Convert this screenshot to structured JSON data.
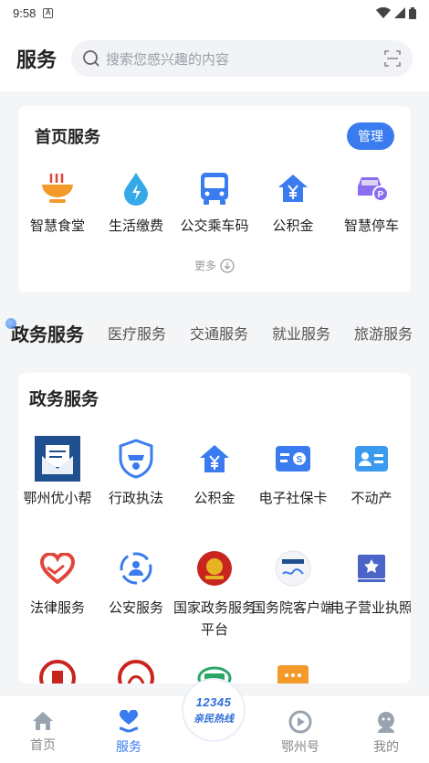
{
  "status_bar": {
    "time": "9:58",
    "notification_letter": "A"
  },
  "header": {
    "title": "服务",
    "search_placeholder": "搜索您感兴趣的内容"
  },
  "home_services": {
    "title": "首页服务",
    "manage_label": "管理",
    "more_label": "更多",
    "items": [
      {
        "label": "智慧食堂",
        "icon": "noodle-bowl-icon"
      },
      {
        "label": "生活缴费",
        "icon": "water-drop-icon"
      },
      {
        "label": "公交乘车码",
        "icon": "bus-icon"
      },
      {
        "label": "公积金",
        "icon": "house-yen-icon"
      },
      {
        "label": "智慧停车",
        "icon": "car-parking-icon"
      }
    ]
  },
  "tabs": [
    "政务服务",
    "医疗服务",
    "交通服务",
    "就业服务",
    "旅游服务"
  ],
  "gov_services": {
    "title": "政务服务",
    "items": [
      {
        "label": "鄂州优小帮",
        "icon": "mail-app-icon"
      },
      {
        "label": "行政执法",
        "icon": "police-badge-icon"
      },
      {
        "label": "公积金",
        "icon": "house-yen-icon"
      },
      {
        "label": "电子社保卡",
        "icon": "social-card-icon"
      },
      {
        "label": "不动产",
        "icon": "id-card-icon"
      },
      {
        "label": "法律服务",
        "icon": "heart-hands-icon"
      },
      {
        "label": "公安服务",
        "icon": "people-shield-icon"
      },
      {
        "label": "国家政务服务平台",
        "icon": "national-emblem-icon"
      },
      {
        "label": "国务院客户端",
        "icon": "state-council-icon"
      },
      {
        "label": "电子营业执照",
        "icon": "license-star-icon"
      },
      {
        "label": "",
        "icon": "court-emblem-icon"
      },
      {
        "label": "",
        "icon": "procuratorate-emblem-icon"
      },
      {
        "label": "",
        "icon": "e-service-logo-icon"
      },
      {
        "label": "",
        "icon": "chat-bubble-icon"
      }
    ]
  },
  "hotline": {
    "number": "12345",
    "label": "亲民热线"
  },
  "bottom_nav": [
    {
      "label": "首页",
      "icon": "home-icon",
      "active": false
    },
    {
      "label": "服务",
      "icon": "heart-hand-icon",
      "active": true
    },
    {
      "label": "鄂州号",
      "icon": "play-circle-icon",
      "active": false
    },
    {
      "label": "我的",
      "icon": "user-icon",
      "active": false
    }
  ],
  "colors": {
    "accent": "#3a7cf0",
    "orange": "#f39a2b",
    "red": "#e0463c"
  }
}
